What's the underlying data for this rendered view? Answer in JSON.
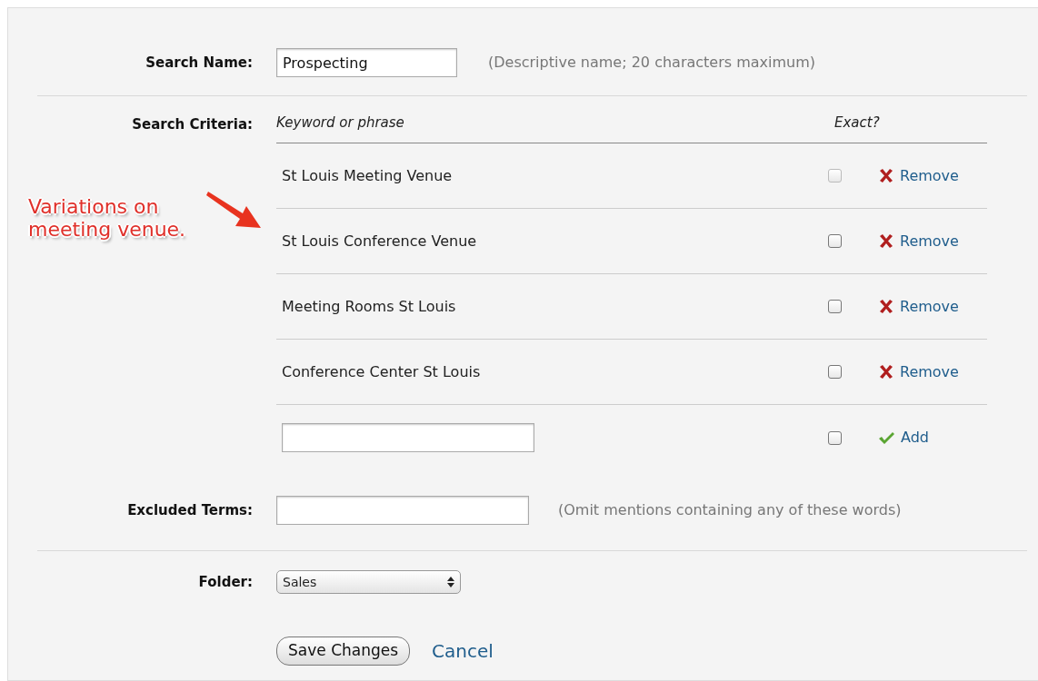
{
  "search_name": {
    "label": "Search Name:",
    "value": "Prospecting",
    "hint": "(Descriptive name; 20 characters maximum)"
  },
  "search_criteria": {
    "label": "Search Criteria:",
    "columns": [
      "Keyword or phrase",
      "Exact?"
    ],
    "rows": [
      {
        "kind": "existing",
        "keyword": "St Louis Meeting Venue",
        "checked": false,
        "disabled": true,
        "action": "Remove"
      },
      {
        "kind": "existing",
        "keyword": "St Louis Conference Venue",
        "checked": false,
        "disabled": false,
        "action": "Remove"
      },
      {
        "kind": "existing",
        "keyword": "Meeting Rooms St Louis",
        "checked": false,
        "disabled": false,
        "action": "Remove"
      },
      {
        "kind": "existing",
        "keyword": "Conference Center St Louis",
        "checked": false,
        "disabled": false,
        "action": "Remove"
      },
      {
        "kind": "new",
        "checked": false,
        "disabled": false,
        "action": "Add"
      }
    ]
  },
  "excluded_terms": {
    "label": "Excluded Terms:",
    "hint": "(Omit mentions containing any of these words)"
  },
  "folder": {
    "label": "Folder:",
    "value": "Sales"
  },
  "buttons": {
    "save": "Save Changes",
    "cancel": "Cancel"
  },
  "annotation": {
    "lines": [
      "Variations on",
      "meeting venue."
    ]
  }
}
